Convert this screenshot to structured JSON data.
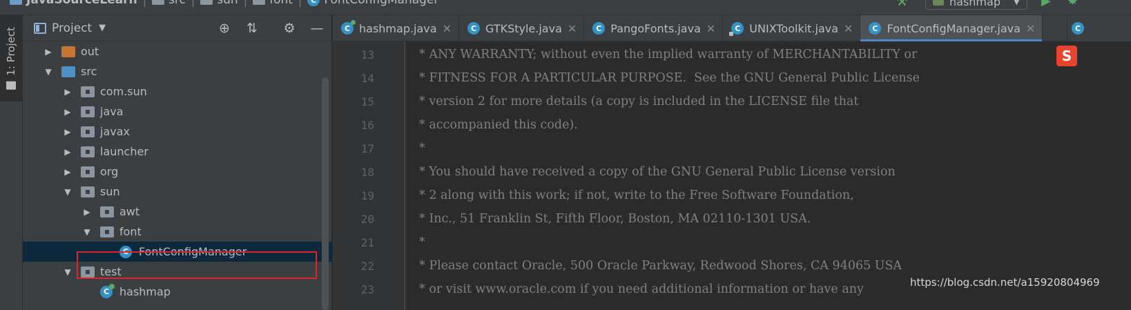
{
  "breadcrumb": [
    {
      "label": "JavaSourceLearn",
      "icon": "module-icon"
    },
    {
      "label": "src",
      "icon": "folder-icon"
    },
    {
      "label": "sun",
      "icon": "package-icon"
    },
    {
      "label": "font",
      "icon": "package-icon"
    },
    {
      "label": "FontConfigManager",
      "icon": "class-icon"
    }
  ],
  "run_config": {
    "label": "hashmap"
  },
  "left_strip": {
    "tab_label": "1: Project"
  },
  "project_panel": {
    "title": "Project"
  },
  "tree": [
    {
      "label": "out",
      "kind": "folder-orange",
      "expanded": false,
      "depth": 0
    },
    {
      "label": "src",
      "kind": "folder-blue",
      "expanded": true,
      "depth": 0
    },
    {
      "label": "com.sun",
      "kind": "package",
      "expanded": false,
      "depth": 1
    },
    {
      "label": "java",
      "kind": "package",
      "expanded": false,
      "depth": 1
    },
    {
      "label": "javax",
      "kind": "package",
      "expanded": false,
      "depth": 1
    },
    {
      "label": "launcher",
      "kind": "package",
      "expanded": false,
      "depth": 1
    },
    {
      "label": "org",
      "kind": "package",
      "expanded": false,
      "depth": 1
    },
    {
      "label": "sun",
      "kind": "package",
      "expanded": true,
      "depth": 1
    },
    {
      "label": "awt",
      "kind": "package",
      "expanded": false,
      "depth": 2
    },
    {
      "label": "font",
      "kind": "package",
      "expanded": true,
      "depth": 2
    },
    {
      "label": "FontConfigManager",
      "kind": "class",
      "selected": true,
      "depth": 3
    },
    {
      "label": "test",
      "kind": "package",
      "expanded": true,
      "depth": 1
    },
    {
      "label": "hashmap",
      "kind": "class-runnable",
      "depth": 2
    }
  ],
  "tabs": [
    {
      "label": "hashmap.java",
      "icon": "class-runnable"
    },
    {
      "label": "GTKStyle.java",
      "icon": "class"
    },
    {
      "label": "PangoFonts.java",
      "icon": "class"
    },
    {
      "label": "UNIXToolkit.java",
      "icon": "class-locked"
    },
    {
      "label": "FontConfigManager.java",
      "icon": "class",
      "active": true
    }
  ],
  "editor": {
    "lines": [
      {
        "num": "13",
        "text": "* ANY WARRANTY; without even the implied warranty of MERCHANTABILITY or"
      },
      {
        "num": "14",
        "text": "* FITNESS FOR A PARTICULAR PURPOSE.  See the GNU General Public License"
      },
      {
        "num": "15",
        "text": "* version 2 for more details (a copy is included in the LICENSE file that"
      },
      {
        "num": "16",
        "text": "* accompanied this code)."
      },
      {
        "num": "17",
        "text": "*"
      },
      {
        "num": "18",
        "text": "* You should have received a copy of the GNU General Public License version"
      },
      {
        "num": "19",
        "text": "* 2 along with this work; if not, write to the Free Software Foundation,"
      },
      {
        "num": "20",
        "text": "* Inc., 51 Franklin St, Fifth Floor, Boston, MA 02110-1301 USA."
      },
      {
        "num": "21",
        "text": "*"
      },
      {
        "num": "22",
        "text": "* Please contact Oracle, 500 Oracle Parkway, Redwood Shores, CA 94065 USA"
      },
      {
        "num": "23",
        "text": "* or visit www.oracle.com if you need additional information or have any"
      }
    ]
  },
  "overlay": {
    "ime_label": "S",
    "watermark": "https://blog.csdn.net/a15920804969"
  }
}
